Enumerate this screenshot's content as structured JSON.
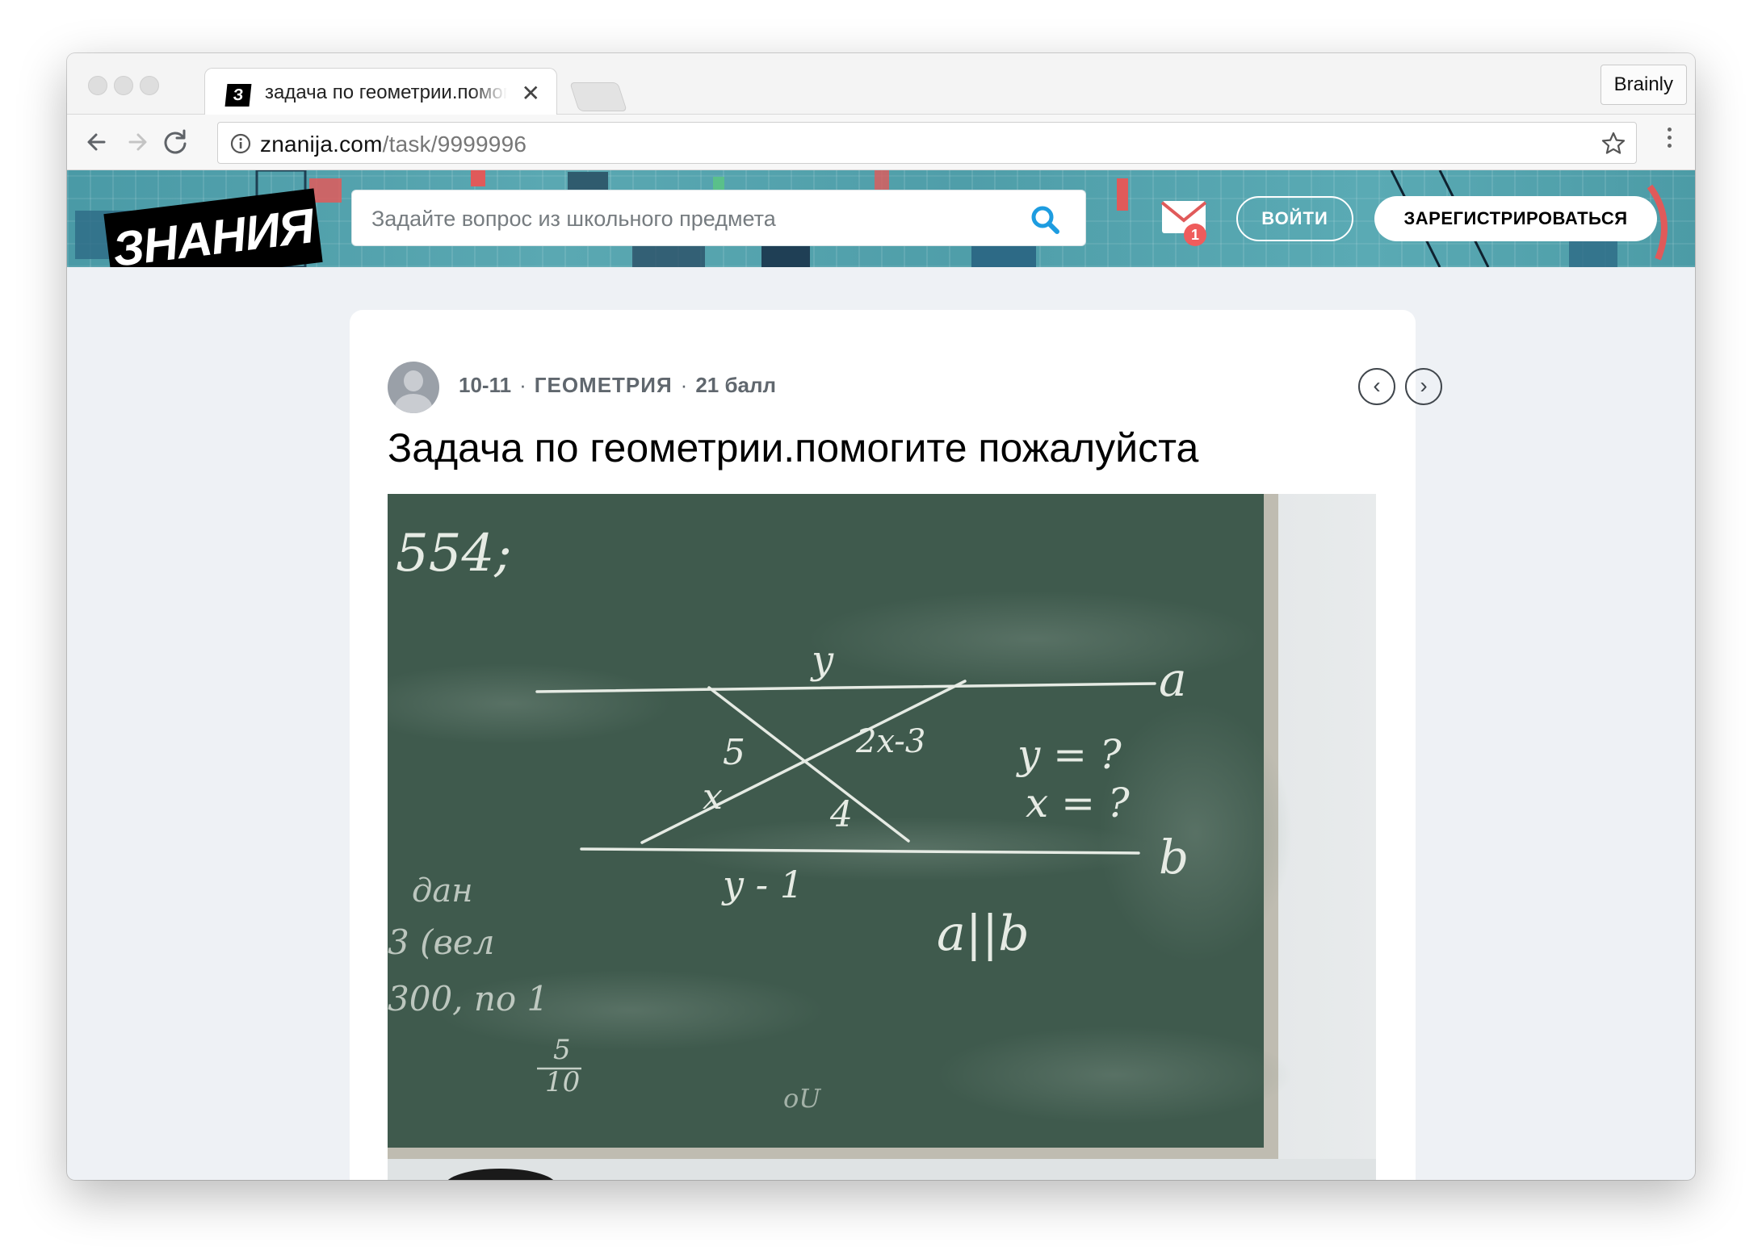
{
  "browser": {
    "tab_title": "задача по геометрии.помогите пожалуйста",
    "tab_favicon": "З",
    "tab_close": "✕",
    "profile_name": "Brainly",
    "url_host": "znanija.com",
    "url_path": "/task/9999996"
  },
  "header": {
    "logo": "ЗНАНИЯ",
    "search_placeholder": "Задайте вопрос из школьного предмета",
    "notification_count": "1",
    "login_label": "ВОЙТИ",
    "register_label": "ЗАРЕГИСТРИРОВАТЬСЯ"
  },
  "question": {
    "grade": "10-11",
    "separator": "·",
    "subject": "ГЕОМЕТРИЯ",
    "points": "21 балл",
    "prev_label": "‹",
    "next_label": "›",
    "title": "Задача по геометрии.помогите пожалуйста"
  },
  "photo": {
    "board_texts": {
      "problem_number": "554;",
      "top_segment": "y",
      "line_a": "a",
      "segment_5": "5",
      "segment_2x3": "2x-3",
      "segment_x": "x",
      "segment_4": "4",
      "bottom_segment": "y - 1",
      "line_b": "b",
      "question_y": "y = ?",
      "question_x": "x = ?",
      "parallel": "a||b",
      "left_scrawl_1": "дан",
      "left_scrawl_2": "3 (вел",
      "left_scrawl_3": "300, по 1",
      "fraction_num": "5",
      "fraction_den": "10",
      "bottom_scrawl": "оU"
    }
  },
  "colors": {
    "header_teal": "#4f9ea9",
    "page_bg": "#eef1f5",
    "chalkboard": "#3f5a4d",
    "chalk": "#e6ebe4",
    "badge_red": "#ef5c5c",
    "search_icon_blue": "#1d9ce0"
  }
}
